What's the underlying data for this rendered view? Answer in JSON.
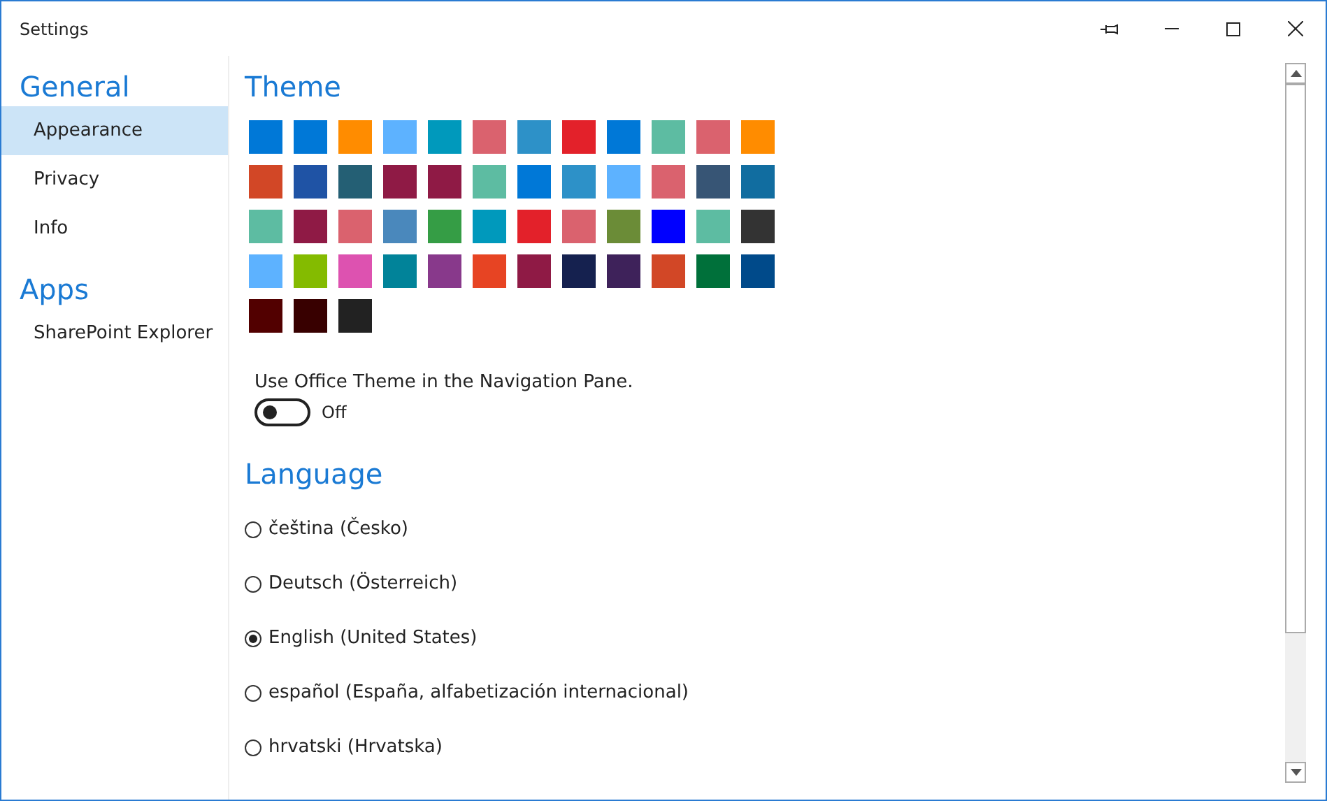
{
  "window": {
    "title": "Settings"
  },
  "sidebar": {
    "sections": [
      {
        "title": "General",
        "items": [
          {
            "label": "Appearance",
            "selected": true
          },
          {
            "label": "Privacy",
            "selected": false
          },
          {
            "label": "Info",
            "selected": false
          }
        ]
      },
      {
        "title": "Apps",
        "items": [
          {
            "label": "SharePoint Explorer",
            "selected": false
          }
        ]
      }
    ]
  },
  "theme": {
    "title": "Theme",
    "swatches": [
      {
        "color": "#0078d7"
      },
      {
        "color": "#0078d7"
      },
      {
        "color": "#ff8c00"
      },
      {
        "color": "#5db2ff"
      },
      {
        "color": "#0099bc"
      },
      {
        "color": "#da626e"
      },
      {
        "color": "#2d91c8"
      },
      {
        "color": "#e3212a"
      },
      {
        "color": "#0078d7"
      },
      {
        "color": "#5dbca2"
      },
      {
        "color": "#da626e"
      },
      {
        "color": "#ff8c00"
      },
      {
        "color": "#d24726"
      },
      {
        "color": "#1f53a5"
      },
      {
        "color": "#245f74"
      },
      {
        "color": "#8f1a45"
      },
      {
        "color": "#8f1a45"
      },
      {
        "color": "#5dbca2"
      },
      {
        "color": "#0078d7"
      },
      {
        "color": "#2d91c8"
      },
      {
        "color": "#5db2ff"
      },
      {
        "color": "#da626e"
      },
      {
        "color": "#375575"
      },
      {
        "color": "#116da0"
      },
      {
        "color": "#5dbca2"
      },
      {
        "color": "#8f1a45"
      },
      {
        "color": "#da626e"
      },
      {
        "color": "#4a88bc"
      },
      {
        "color": "#359d45"
      },
      {
        "color": "#0099bc"
      },
      {
        "color": "#e3212a"
      },
      {
        "color": "#da626e"
      },
      {
        "color": "#6b8c37"
      },
      {
        "color": "#0000ff"
      },
      {
        "color": "#5dbca2"
      },
      {
        "color": "#333333"
      },
      {
        "color": "#5db2ff"
      },
      {
        "color": "#84bb00"
      },
      {
        "color": "#dd52b0"
      },
      {
        "color": "#018399"
      },
      {
        "color": "#88398b"
      },
      {
        "color": "#e74423"
      },
      {
        "color": "#8f1a45"
      },
      {
        "color": "#15214f"
      },
      {
        "color": "#3e225a"
      },
      {
        "color": "#d24726"
      },
      {
        "color": "#00703a"
      },
      {
        "color": "#004a8a"
      },
      {
        "color": "#520000"
      },
      {
        "color": "#380000"
      },
      {
        "color": "#222222"
      }
    ],
    "office_theme": {
      "label": "Use Office Theme in the Navigation Pane.",
      "on": false,
      "state_label": "Off"
    }
  },
  "language": {
    "title": "Language",
    "options": [
      {
        "label": "čeština (Česko)",
        "selected": false
      },
      {
        "label": "Deutsch (Österreich)",
        "selected": false
      },
      {
        "label": "English (United States)",
        "selected": true
      },
      {
        "label": "español (España, alfabetización internacional)",
        "selected": false
      },
      {
        "label": "hrvatski (Hrvatska)",
        "selected": false
      }
    ]
  }
}
